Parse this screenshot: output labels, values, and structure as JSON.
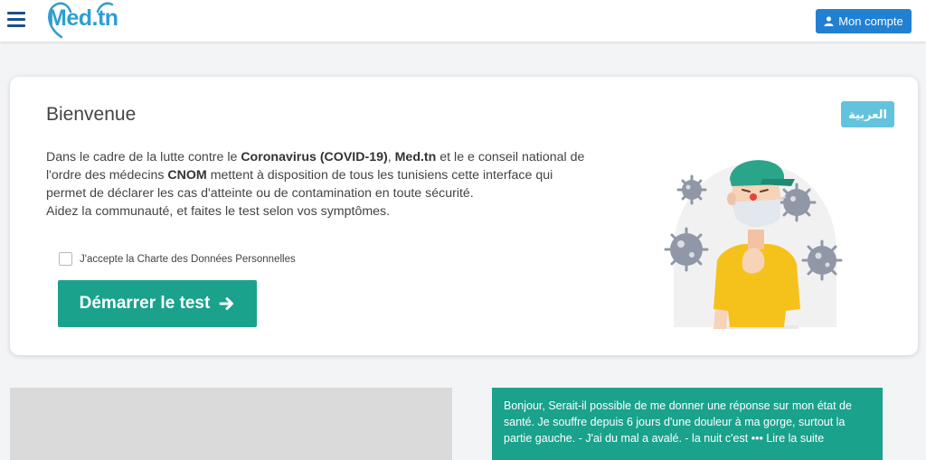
{
  "header": {
    "logo_text": "Med.tn",
    "account_label": "Mon compte",
    "menu_icon": "hamburger-icon",
    "account_icon": "user-icon"
  },
  "welcome": {
    "title": "Bienvenue",
    "language_button": "العربية",
    "intro": {
      "p1": "Dans le cadre de la lutte contre le ",
      "b1": "Coronavirus (COVID-19)",
      "p2": ", ",
      "b2": "Med.tn",
      "p3": " et le e conseil national de l'ordre des médecins ",
      "b3": "CNOM",
      "p4": " mettent à disposition de tous les tunisiens cette interface qui permet de déclarer les cas d'atteinte ou de contamination en toute sécurité.",
      "p5": "Aidez la communauté, et faites le test selon vos symptômes."
    },
    "consent_label": "J'accepte la Charte des Données Personnelles",
    "consent_checked": false,
    "start_button": "Démarrer le test",
    "start_icon": "arrow-right-icon",
    "illustration": "masked-person-with-viruses"
  },
  "testimonial": {
    "text": "Bonjour, Serait-il possible de me donner une réponse sur mon état de santé. Je souffre depuis 6 jours d'une douleur à ma gorge, surtout la partie gauche. - J'ai du mal a avalé. - la nuit c'est",
    "ellipsis": "•••",
    "more_label": "Lire la suite"
  },
  "colors": {
    "primary_blue": "#2280d3",
    "teal": "#1aa28c",
    "light_blue": "#63c3dc",
    "logo_blue": "#2d9fd1"
  }
}
